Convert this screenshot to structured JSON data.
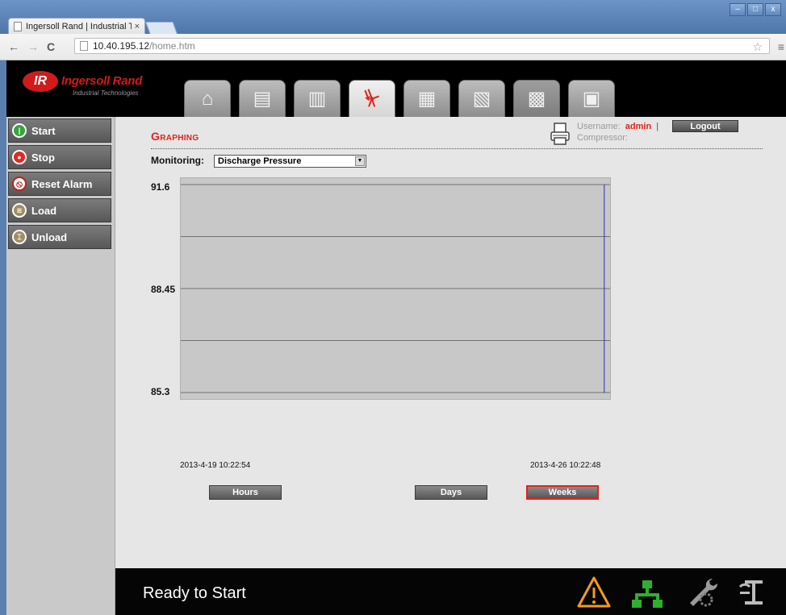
{
  "browser": {
    "tab_title": "Ingersoll Rand | Industrial Te",
    "tab_close": "×",
    "url_host": "10.40.195.12",
    "url_path": "/home.htm",
    "back_icon": "←",
    "forward_icon": "→",
    "reload_icon": "C",
    "star_icon": "☆",
    "menu_icon": "≡",
    "minimize_icon": "–",
    "maximize_icon": "□",
    "close_icon": "x"
  },
  "brand": {
    "logo_mark": "IR",
    "name": "Ingersoll Rand",
    "subtitle": "Industrial Technologies",
    "accent": "#e2221b"
  },
  "nav_tabs": [
    {
      "icon": "home-icon",
      "glyph": "⌂",
      "active": false
    },
    {
      "icon": "status-icon",
      "glyph": "▤",
      "active": false
    },
    {
      "icon": "settings-doc-icon",
      "glyph": "▥",
      "active": false
    },
    {
      "icon": "graphing-icon",
      "glyph": "⏧",
      "active": true
    },
    {
      "icon": "config-icon",
      "glyph": "▦",
      "active": false
    },
    {
      "icon": "search-doc-icon",
      "glyph": "▧",
      "active": false
    },
    {
      "icon": "schedule-icon",
      "glyph": "▩",
      "active": false
    },
    {
      "icon": "id-card-icon",
      "glyph": "▣",
      "active": false
    }
  ],
  "sidebar": {
    "buttons": [
      {
        "label": "Start",
        "icon": "start-icon"
      },
      {
        "label": "Stop",
        "icon": "stop-icon"
      },
      {
        "label": "Reset Alarm",
        "icon": "reset-alarm-icon"
      },
      {
        "label": "Load",
        "icon": "load-icon"
      },
      {
        "label": "Unload",
        "icon": "unload-icon"
      }
    ]
  },
  "page": {
    "title": "Graphing",
    "username_label": "Username:",
    "username": "admin",
    "separator": "|",
    "compressor_label": "Compressor:",
    "logout_label": "Logout",
    "monitoring_label": "Monitoring:",
    "monitoring_value": "Discharge Pressure"
  },
  "chart_data": {
    "type": "line",
    "series": [
      {
        "x": [
          "2013-4-26 10:00:00",
          "2013-4-26 10:00:00",
          "2013-4-26 10:10:00"
        ],
        "values": [
          91.6,
          85.3,
          85.3
        ],
        "color": "#2233bb"
      }
    ],
    "y_ticks": [
      "91.6",
      "88.45",
      "85.3"
    ],
    "ylim": [
      85.3,
      91.6
    ],
    "x_start_label": "2013-4-19 10:22:54",
    "x_end_label": "2013-4-26 10:22:48",
    "grid": true
  },
  "range_buttons": [
    {
      "label": "Hours",
      "selected": false
    },
    {
      "label": "Days",
      "selected": false
    },
    {
      "label": "Weeks",
      "selected": true
    }
  ],
  "footer": {
    "status": "Ready to Start",
    "icons": [
      "warning-icon",
      "network-icon",
      "maintenance-icon",
      "compressor-icon"
    ]
  }
}
